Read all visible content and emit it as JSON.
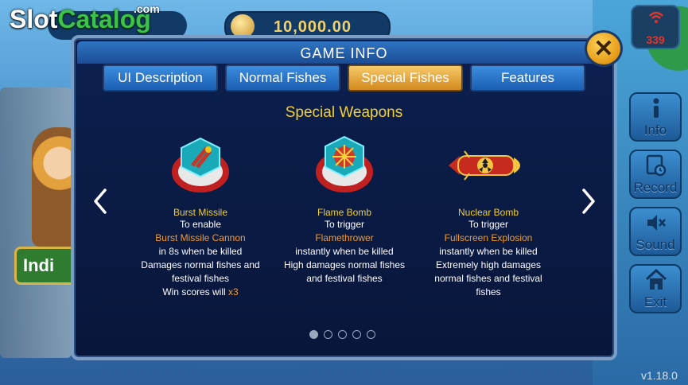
{
  "hud": {
    "coin_balance": "10,000.00",
    "signal_value": "339",
    "version": "v1.18.0",
    "side_buttons": [
      {
        "label": "Info",
        "icon": "info-icon"
      },
      {
        "label": "Record",
        "icon": "record-icon"
      },
      {
        "label": "Sound",
        "icon": "speaker-mute-icon"
      },
      {
        "label": "Exit",
        "icon": "home-icon"
      }
    ],
    "background_banner": "Indi"
  },
  "watermark": {
    "part1": "Slot",
    "part2": "Catalog",
    "suffix": ".com"
  },
  "dialog": {
    "title": "GAME INFO",
    "close_label": "✕",
    "tabs": [
      {
        "label": "UI Description",
        "active": false
      },
      {
        "label": "Normal Fishes",
        "active": false
      },
      {
        "label": "Special Fishes",
        "active": true
      },
      {
        "label": "Features",
        "active": false
      }
    ],
    "section_title": "Special Weapons",
    "pagination": {
      "total": 5,
      "current": 1
    },
    "weapons": [
      {
        "name": "Burst Missile",
        "icon": "burst-missile-icon",
        "lines": [
          {
            "text": "To enable",
            "highlight": false
          },
          {
            "text": "Burst Missile Cannon",
            "highlight": true
          },
          {
            "text": "in 8s when be killed",
            "highlight": false
          },
          {
            "text": "Damages normal fishes and",
            "highlight": false
          },
          {
            "text": "festival fishes",
            "highlight": false
          }
        ],
        "last_line": {
          "text": "Win scores will ",
          "highlight_suffix": "x3"
        }
      },
      {
        "name": "Flame Bomb",
        "icon": "flame-bomb-icon",
        "lines": [
          {
            "text": "To trigger",
            "highlight": false
          },
          {
            "text": "Flamethrower",
            "highlight": true
          },
          {
            "text": "instantly when be killed",
            "highlight": false
          },
          {
            "text": "High damages normal fishes",
            "highlight": false
          },
          {
            "text": "and festival fishes",
            "highlight": false
          }
        ]
      },
      {
        "name": "Nuclear Bomb",
        "icon": "nuclear-bomb-icon",
        "lines": [
          {
            "text": "To trigger",
            "highlight": false
          },
          {
            "text": "Fullscreen Explosion",
            "highlight": true
          },
          {
            "text": "instantly when be killed",
            "highlight": false
          },
          {
            "text": "Extremely high damages",
            "highlight": false
          },
          {
            "text": "normal fishes and festival",
            "highlight": false
          },
          {
            "text": "fishes",
            "highlight": false
          }
        ]
      }
    ]
  }
}
